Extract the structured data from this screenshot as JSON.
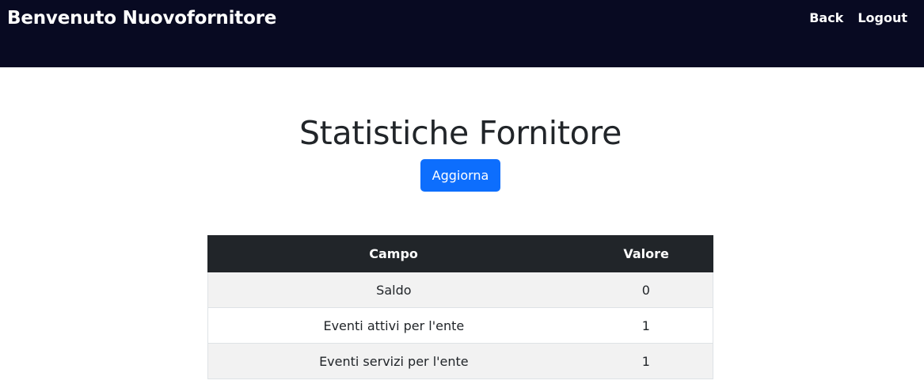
{
  "navbar": {
    "brand": "Benvenuto Nuovofornitore",
    "links": [
      "Back",
      "Logout"
    ]
  },
  "main": {
    "title": "Statistiche Fornitore",
    "refresh_label": "Aggiorna"
  },
  "table": {
    "headers": [
      "Campo",
      "Valore"
    ],
    "rows": [
      {
        "field": "Saldo",
        "value": "0"
      },
      {
        "field": "Eventi attivi per l'ente",
        "value": "1"
      },
      {
        "field": "Eventi servizi per l'ente",
        "value": "1"
      }
    ]
  },
  "colors": {
    "navbar_bg": "#080a22",
    "primary_button": "#0d6efd",
    "table_header_bg": "#212529",
    "striped_row_bg": "#f2f2f2"
  }
}
